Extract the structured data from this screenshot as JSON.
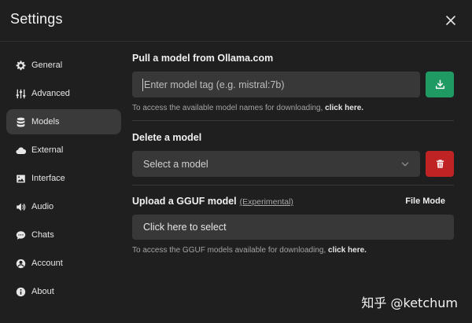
{
  "header": {
    "title": "Settings",
    "close_icon": "close-icon"
  },
  "sidebar": {
    "items": [
      {
        "label": "General",
        "icon": "gear-icon",
        "active": false
      },
      {
        "label": "Advanced",
        "icon": "sliders-icon",
        "active": false
      },
      {
        "label": "Models",
        "icon": "database-icon",
        "active": true
      },
      {
        "label": "External",
        "icon": "cloud-icon",
        "active": false
      },
      {
        "label": "Interface",
        "icon": "image-icon",
        "active": false
      },
      {
        "label": "Audio",
        "icon": "speaker-icon",
        "active": false
      },
      {
        "label": "Chats",
        "icon": "chat-bubble-icon",
        "active": false
      },
      {
        "label": "Account",
        "icon": "user-icon",
        "active": false
      },
      {
        "label": "About",
        "icon": "info-icon",
        "active": false
      }
    ]
  },
  "pull": {
    "heading": "Pull a model from Ollama.com",
    "placeholder": "Enter model tag (e.g. mistral:7b)",
    "download_icon": "download-icon",
    "hint_prefix": "To access the available model names for downloading, ",
    "hint_link": "click here."
  },
  "delete": {
    "heading": "Delete a model",
    "select_value": "Select a model",
    "trash_icon": "trash-icon"
  },
  "upload": {
    "heading": "Upload a GGUF model",
    "experimental": "(Experimental)",
    "mode": "File Mode",
    "button": "Click here to select",
    "hint_prefix": "To access the GGUF models available for downloading, ",
    "hint_link": "click here."
  },
  "watermark": "知乎 @ketchum",
  "colors": {
    "green": "#1f9a63",
    "red": "#bf2323",
    "panel": "#1f1f1f",
    "field": "#383838"
  }
}
